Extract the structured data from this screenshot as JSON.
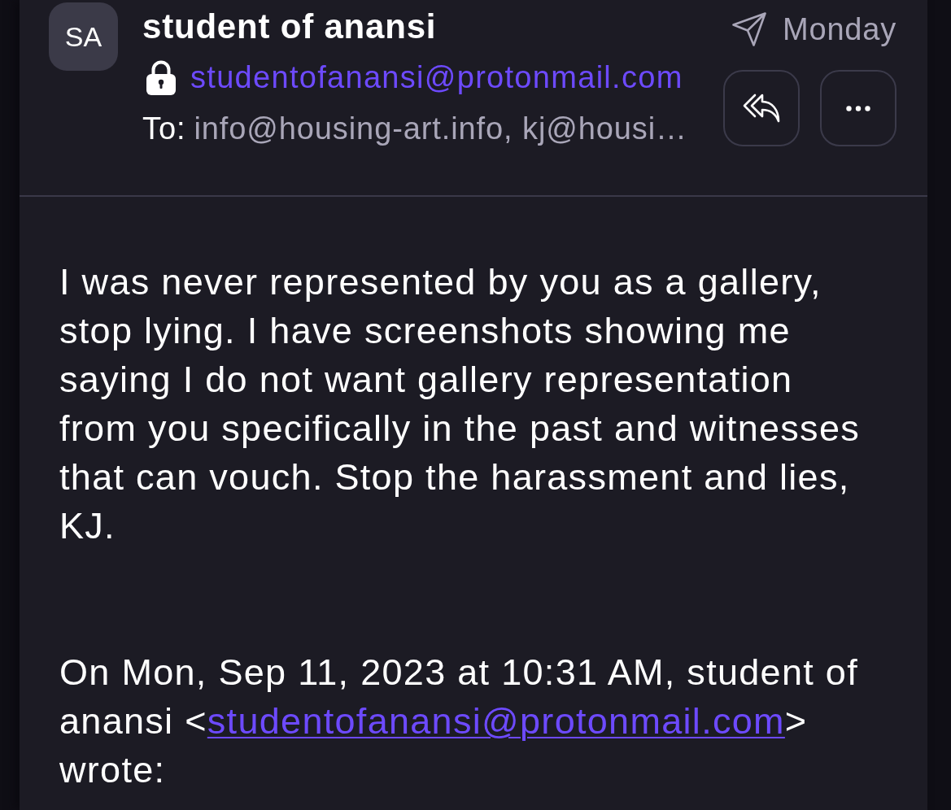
{
  "sender": {
    "initials": "SA",
    "name": "student of anansi",
    "address": "studentofanansi@protonmail.com",
    "encrypted": true,
    "recipients_label": "To:",
    "recipients": "info@housing-art.info, kj@housi…"
  },
  "date": {
    "label": "Monday",
    "sent": true
  },
  "actions": [
    {
      "kind": "reply-all"
    },
    {
      "kind": "more"
    }
  ],
  "body": {
    "message": "I was never represented by you as a gallery, stop lying. I have screenshots showing me saying I do not want gallery representation from you specifically in the past and witnesses that can vouch. Stop the harassment and lies, KJ.",
    "quote": {
      "intro": "On Mon, Sep 11, 2023 at 10:31 AM, student of anansi <",
      "link": "studentofanansi@protonmail.com",
      "outro": "> wrote:"
    }
  }
}
